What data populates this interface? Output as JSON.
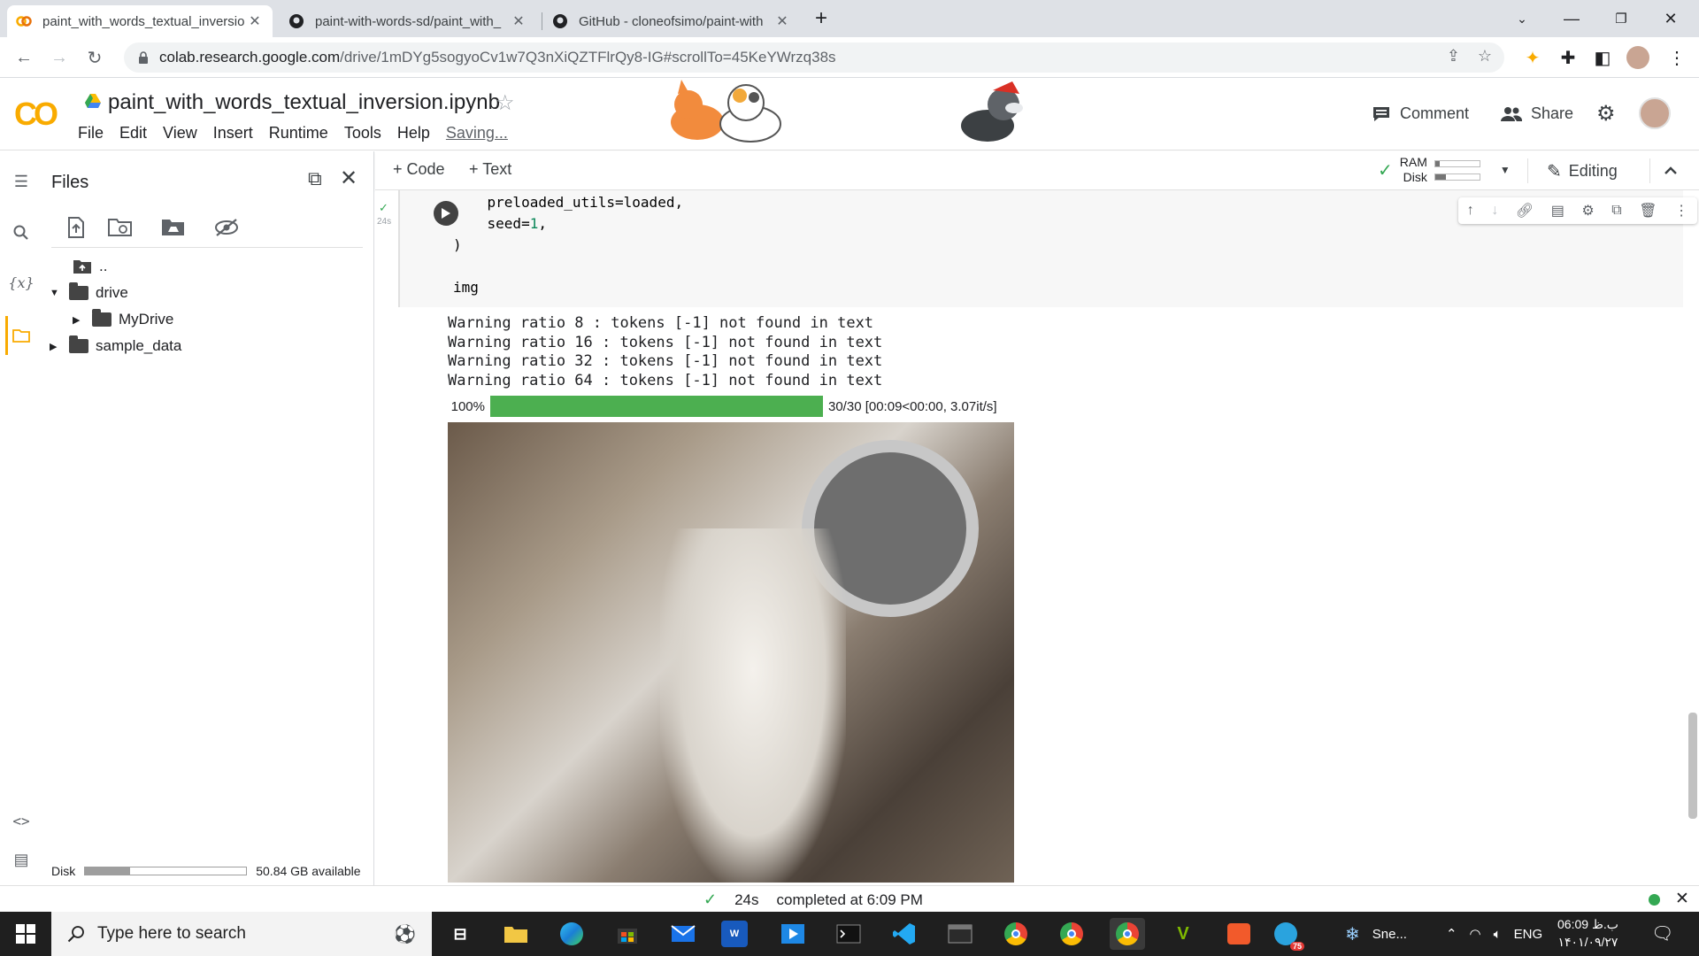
{
  "browser": {
    "tabs": [
      {
        "title": "paint_with_words_textual_inversio",
        "active": true
      },
      {
        "title": "paint-with-words-sd/paint_with_",
        "active": false
      },
      {
        "title": "GitHub - cloneofsimo/paint-with",
        "active": false
      }
    ],
    "url_host": "colab.research.google.com",
    "url_path": "/drive/1mDYg5sogyoCv1w7Q3nXiQZTFlrQy8-IG#scrollTo=45KeYWrzq38s"
  },
  "colab": {
    "logo": "CO",
    "notebook_title": "paint_with_words_textual_inversion.ipynb",
    "menus": [
      "File",
      "Edit",
      "View",
      "Insert",
      "Runtime",
      "Tools",
      "Help"
    ],
    "saving_label": "Saving...",
    "comment_label": "Comment",
    "share_label": "Share"
  },
  "files_panel": {
    "title": "Files",
    "parent": "..",
    "items": [
      {
        "name": "drive",
        "expanded": true
      },
      {
        "name": "MyDrive",
        "expanded": false
      },
      {
        "name": "sample_data",
        "expanded": false
      }
    ],
    "disk_label": "Disk",
    "disk_available": "50.84 GB available",
    "disk_used_fraction": 0.28
  },
  "toolbar": {
    "add_code": "Code",
    "add_text": "Text",
    "ram_label": "RAM",
    "disk_label": "Disk",
    "ram_fraction": 0.1,
    "disk_fraction": 0.25,
    "editing_label": "Editing"
  },
  "cell": {
    "exec_time": "24s",
    "code_line1": "    preloaded_utils=loaded,",
    "code_line2_key": "    seed=",
    "code_line2_val": "1",
    "code_line2_end": ",",
    "code_line3": ")",
    "code_line5": "img"
  },
  "output": {
    "warnings": [
      "Warning ratio 8 : tokens [-1] not found in text",
      "Warning ratio 16 : tokens [-1] not found in text",
      "Warning ratio 32 : tokens [-1] not found in text",
      "Warning ratio 64 : tokens [-1] not found in text"
    ],
    "progress_percent": "100%",
    "progress_fraction": 1.0,
    "progress_text": "30/30 [00:09<00:00, 3.07it/s]"
  },
  "statusbar": {
    "time": "24s",
    "completed": "completed at 6:09 PM"
  },
  "taskbar": {
    "search_placeholder": "Type here to search",
    "weather": "Sne...",
    "lang": "ENG",
    "clock_time": "06:09 ب.ظ",
    "clock_date": "۱۴۰۱/۰۹/۲۷",
    "telegram_badge": "75"
  },
  "colors": {
    "progress_green": "#4caf50",
    "colab_orange": "#f9ab00",
    "status_green": "#34a853"
  }
}
